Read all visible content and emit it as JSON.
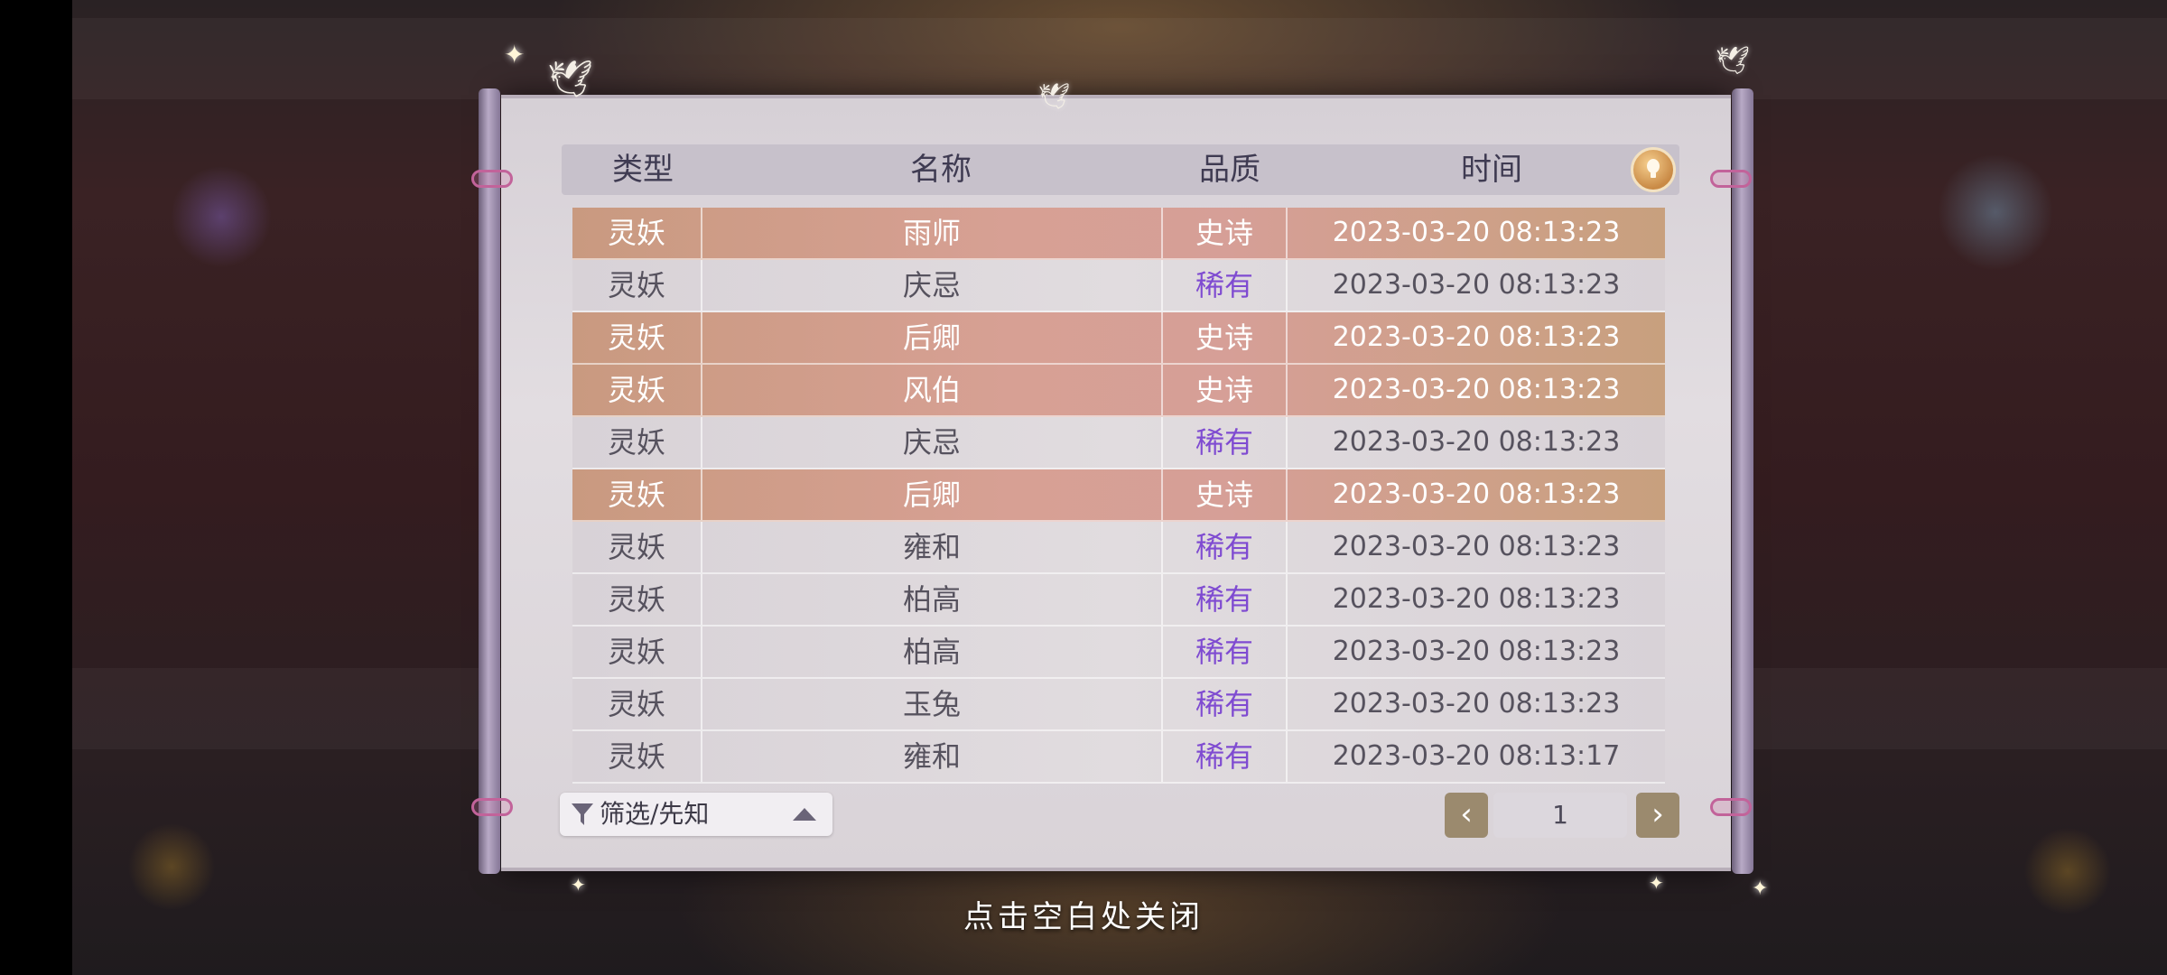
{
  "header": {
    "col_type": "类型",
    "col_name": "名称",
    "col_quality": "品质",
    "col_time": "时间"
  },
  "hint_icon": "lightbulb-icon",
  "colors": {
    "epic_row": "#d29f8c",
    "rare_text": "#7f4bd1",
    "pager_button": "#9b8a6e"
  },
  "rows": [
    {
      "type": "灵妖",
      "name": "雨师",
      "quality": "史诗",
      "time": "2023-03-20  08:13:23",
      "tier": "epic"
    },
    {
      "type": "灵妖",
      "name": "庆忌",
      "quality": "稀有",
      "time": "2023-03-20  08:13:23",
      "tier": "rare"
    },
    {
      "type": "灵妖",
      "name": "后卿",
      "quality": "史诗",
      "time": "2023-03-20  08:13:23",
      "tier": "epic"
    },
    {
      "type": "灵妖",
      "name": "风伯",
      "quality": "史诗",
      "time": "2023-03-20  08:13:23",
      "tier": "epic"
    },
    {
      "type": "灵妖",
      "name": "庆忌",
      "quality": "稀有",
      "time": "2023-03-20  08:13:23",
      "tier": "rare"
    },
    {
      "type": "灵妖",
      "name": "后卿",
      "quality": "史诗",
      "time": "2023-03-20  08:13:23",
      "tier": "epic"
    },
    {
      "type": "灵妖",
      "name": "雍和",
      "quality": "稀有",
      "time": "2023-03-20  08:13:23",
      "tier": "rare"
    },
    {
      "type": "灵妖",
      "name": "柏高",
      "quality": "稀有",
      "time": "2023-03-20  08:13:23",
      "tier": "rare"
    },
    {
      "type": "灵妖",
      "name": "柏高",
      "quality": "稀有",
      "time": "2023-03-20  08:13:23",
      "tier": "rare"
    },
    {
      "type": "灵妖",
      "name": "玉兔",
      "quality": "稀有",
      "time": "2023-03-20  08:13:23",
      "tier": "rare"
    },
    {
      "type": "灵妖",
      "name": "雍和",
      "quality": "稀有",
      "time": "2023-03-20  08:13:17",
      "tier": "rare"
    }
  ],
  "filter": {
    "label": "筛选/先知",
    "icon": "filter-icon",
    "arrow_icon": "triangle-up-icon"
  },
  "pager": {
    "prev_label": "‹",
    "page": "1",
    "next_label": "›"
  },
  "close_hint": "点击空白处关闭"
}
